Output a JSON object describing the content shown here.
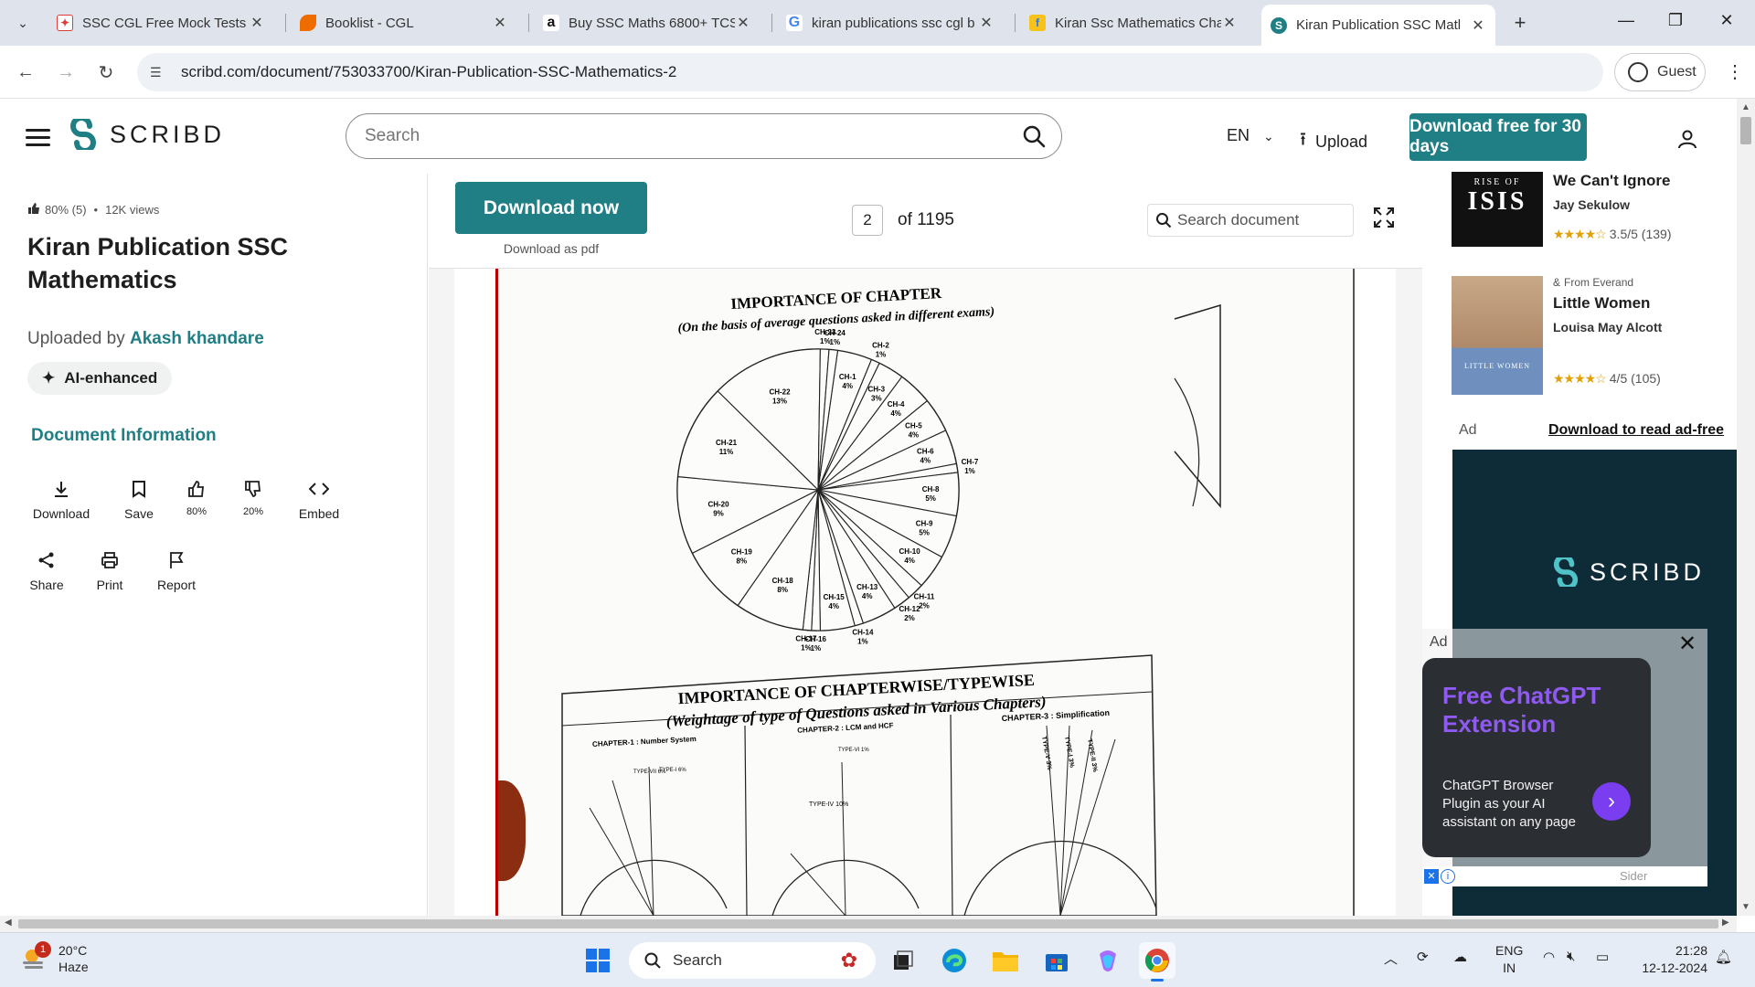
{
  "browser": {
    "tabs": [
      {
        "title": "SSC CGL Free Mock Tests 2",
        "icon": "testbook-icon",
        "color": "#e03a3a"
      },
      {
        "title": "Booklist - CGL",
        "icon": "arc-icon",
        "color": "#ef6c00"
      },
      {
        "title": "Buy SSC Maths 6800+ TCS",
        "icon": "amazon-icon",
        "color": "#111111"
      },
      {
        "title": "kiran publications ssc cgl b",
        "icon": "google-icon",
        "color": "#4285f4"
      },
      {
        "title": "Kiran Ssc Mathematics Cha",
        "icon": "flipkart-icon",
        "color": "#f7c31a"
      },
      {
        "title": "Kiran Publication SSC Matl",
        "icon": "scribd-icon",
        "color": "#1f7f85"
      }
    ],
    "url": "scribd.com/document/753033700/Kiran-Publication-SSC-Mathematics-2",
    "profile": "Guest"
  },
  "header": {
    "logo": "SCRIBD",
    "search_placeholder": "Search",
    "language": "EN",
    "upload": "Upload",
    "cta": "Download free for 30 days"
  },
  "doc": {
    "rating": "80% (5)",
    "views": "12K views",
    "title": "Kiran Publication SSC Mathematics",
    "uploaded_by": "Uploaded by",
    "uploader": "Akash khandare",
    "ai_badge": "AI-enhanced",
    "doc_info": "Document Information",
    "actions": [
      {
        "label": "Download",
        "icon": "download-icon"
      },
      {
        "label": "Save",
        "icon": "bookmark-icon"
      },
      {
        "label": "80%",
        "icon": "thumbs-up-icon"
      },
      {
        "label": "20%",
        "icon": "thumbs-down-icon"
      },
      {
        "label": "Embed",
        "icon": "code-icon"
      },
      {
        "label": "Share",
        "icon": "share-icon"
      },
      {
        "label": "Print",
        "icon": "printer-icon"
      },
      {
        "label": "Report",
        "icon": "flag-icon"
      }
    ]
  },
  "viewer": {
    "download_now": "Download now",
    "download_pdf": "Download as pdf",
    "page": "2",
    "of_pages": "of 1195",
    "search_doc": "Search document"
  },
  "scan": {
    "title1": "IMPORTANCE OF CHAPTER",
    "title2": "(On the basis of average questions asked in different exams)",
    "title3": "IMPORTANCE OF CHAPTERWISE/TYPEWISE",
    "title4": "(Weightage of type of Questions asked in Various Chapters)",
    "sub1": "CHAPTER-1 : Number System",
    "sub2": "CHAPTER-2 : LCM and HCF",
    "sub3": "CHAPTER-3 : Simplification",
    "sub1_labels": [
      "TYPE-VII 6%",
      "TYPE-I 6%"
    ],
    "sub2_labels": [
      "TYPE-VI 1%",
      "TYPE-IV 10%"
    ],
    "sub3_labels": [
      "TYPE-V 3%",
      "TYPE-I 3%",
      "TYPE-II 3%"
    ]
  },
  "chart_data": {
    "type": "pie",
    "title": "IMPORTANCE OF CHAPTER",
    "subtitle": "(On the basis of average questions asked in different exams)",
    "categories": [
      "CH-1",
      "CH-2",
      "CH-3",
      "CH-4",
      "CH-5",
      "CH-6",
      "CH-7",
      "CH-8",
      "CH-9",
      "CH-10",
      "CH-11",
      "CH-12",
      "CH-13",
      "CH-14",
      "CH-15",
      "CH-16",
      "CH-17",
      "CH-18",
      "CH-19",
      "CH-20",
      "CH-21",
      "CH-22",
      "CH-23",
      "CH-24"
    ],
    "values": [
      4,
      1,
      3,
      4,
      4,
      4,
      1,
      5,
      5,
      4,
      2,
      2,
      4,
      1,
      4,
      1,
      1,
      8,
      8,
      9,
      11,
      13,
      1,
      1
    ]
  },
  "sidebar_books": [
    {
      "title": "We Can't Ignore",
      "author": "Jay Sekulow",
      "rating": "3.5/5 (139)",
      "from": "",
      "cover_title": "ISIS",
      "cover_top": "RISE OF"
    },
    {
      "title": "Little Women",
      "author": "Louisa May Alcott",
      "rating": "4/5 (105)",
      "from": "From Everand",
      "cover_title": "LITTLE WOMEN",
      "cover_top": ""
    }
  ],
  "ad": {
    "label": "Ad",
    "adfree": "Download to read ad-free",
    "banner_logo": "SCRIBD"
  },
  "popup": {
    "ad_label": "Ad",
    "heading": "Free ChatGPT Extension",
    "body": "ChatGPT Browser Plugin as your AI assistant on any page",
    "footer": "Sider"
  },
  "taskbar": {
    "temp": "20°C",
    "condition": "Haze",
    "notif_count": "1",
    "search": "Search",
    "lang1": "ENG",
    "lang2": "IN",
    "time": "21:28",
    "date": "12-12-2024"
  }
}
